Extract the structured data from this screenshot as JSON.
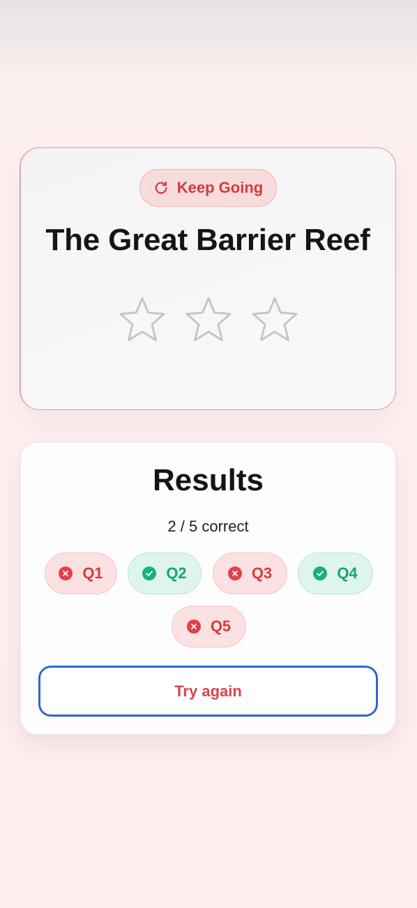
{
  "hero": {
    "status_label": "Keep Going",
    "status_icon": "refresh-icon",
    "title": "The Great Barrier Reef",
    "stars_earned": 0,
    "stars_total": 3
  },
  "results": {
    "title": "Results",
    "score_text": "2 / 5 correct",
    "questions": [
      {
        "label": "Q1",
        "status": "wrong",
        "icon": "x-circle-icon"
      },
      {
        "label": "Q2",
        "status": "right",
        "icon": "check-circle-icon"
      },
      {
        "label": "Q3",
        "status": "wrong",
        "icon": "x-circle-icon"
      },
      {
        "label": "Q4",
        "status": "right",
        "icon": "check-circle-icon"
      },
      {
        "label": "Q5",
        "status": "wrong",
        "icon": "x-circle-icon"
      }
    ],
    "try_again_label": "Try again"
  },
  "colors": {
    "wrong": "#d83a3a",
    "right": "#15a574",
    "button_border": "#2f67d3",
    "button_text": "#d8434a"
  }
}
